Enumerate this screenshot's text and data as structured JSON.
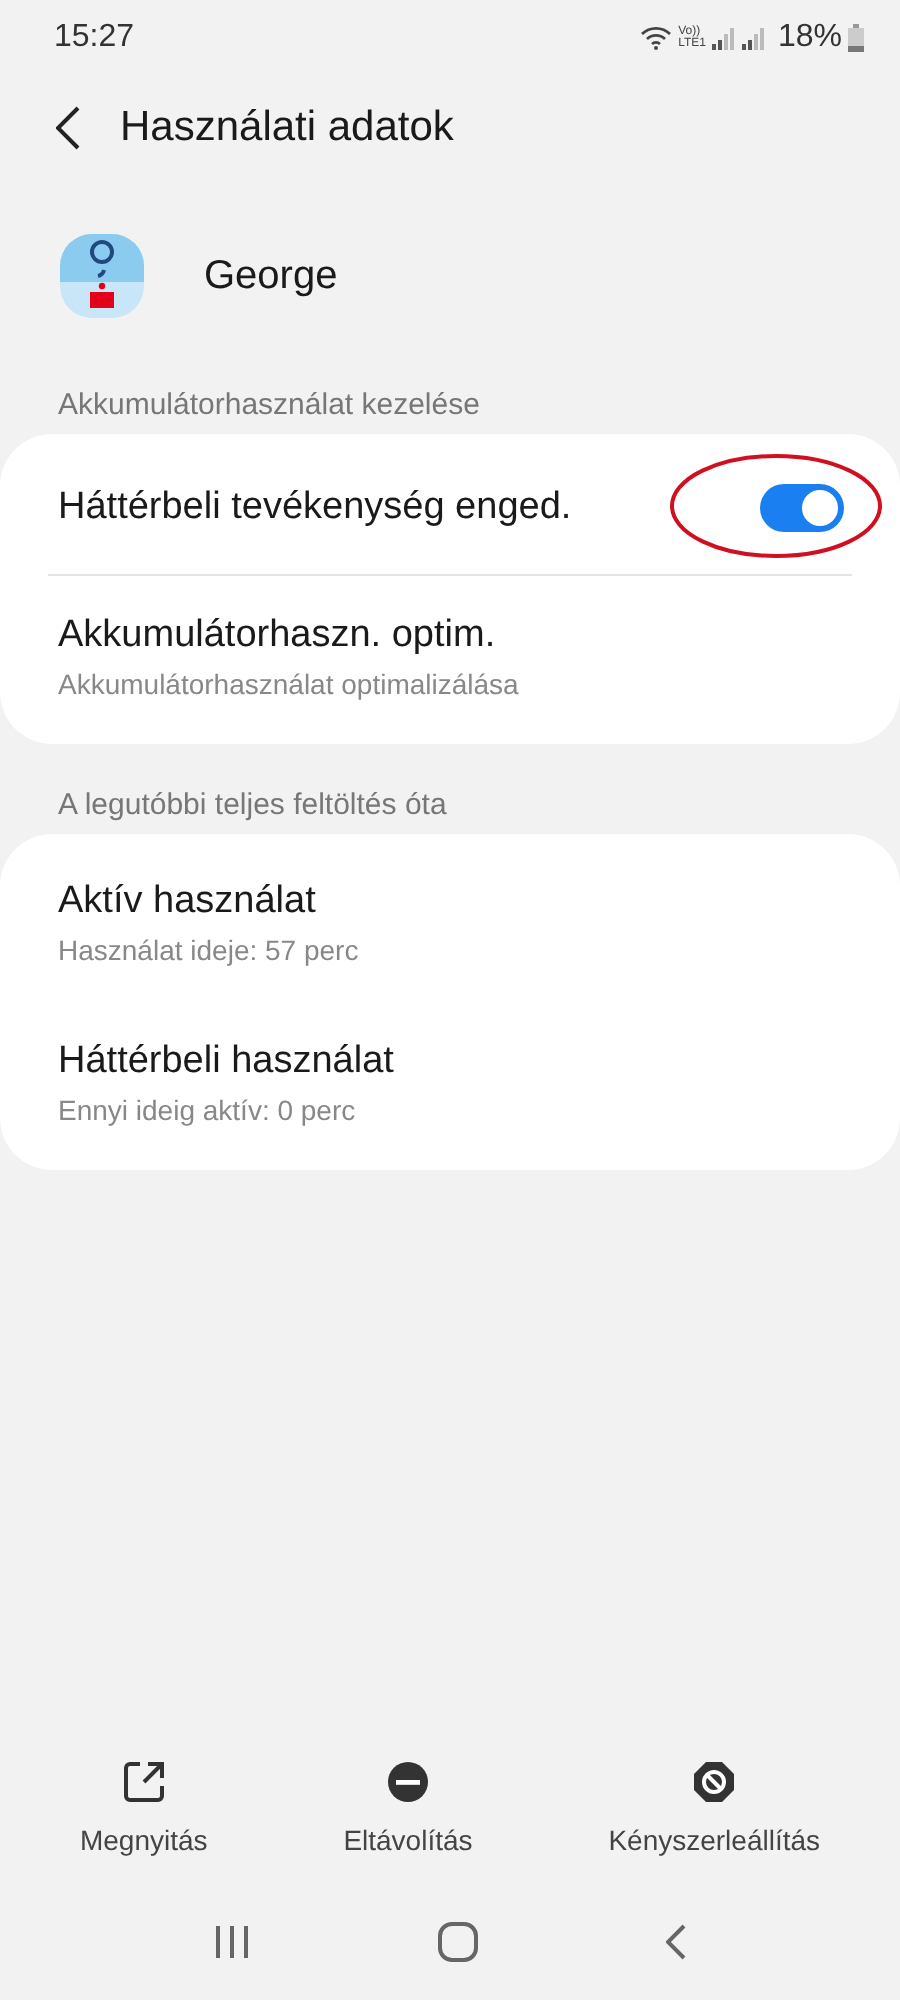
{
  "status_bar": {
    "time": "15:27",
    "volte_top": "Vo))",
    "volte_bottom": "LTE1",
    "battery": "18%"
  },
  "header": {
    "title": "Használati adatok"
  },
  "app": {
    "name": "George"
  },
  "sections": [
    {
      "label": "Akkumulátorhasználat kezelése",
      "rows": [
        {
          "kind": "toggle",
          "title": "Háttérbeli tevékenység enged.",
          "on": true,
          "highlighted": true
        },
        {
          "kind": "text",
          "title": "Akkumulátorhaszn. optim.",
          "subtitle": "Akkumulátorhasználat optimalizálása"
        }
      ]
    },
    {
      "label": "A legutóbbi teljes feltöltés óta",
      "rows": [
        {
          "kind": "text",
          "title": "Aktív használat",
          "subtitle": "Használat ideje: 57 perc"
        },
        {
          "kind": "text",
          "title": "Háttérbeli használat",
          "subtitle": "Ennyi ideig aktív: 0 perc"
        }
      ]
    }
  ],
  "actions": [
    {
      "kind": "open",
      "label": "Megnyitás"
    },
    {
      "kind": "remove",
      "label": "Eltávolítás"
    },
    {
      "kind": "stop",
      "label": "Kényszerleállítás"
    }
  ]
}
